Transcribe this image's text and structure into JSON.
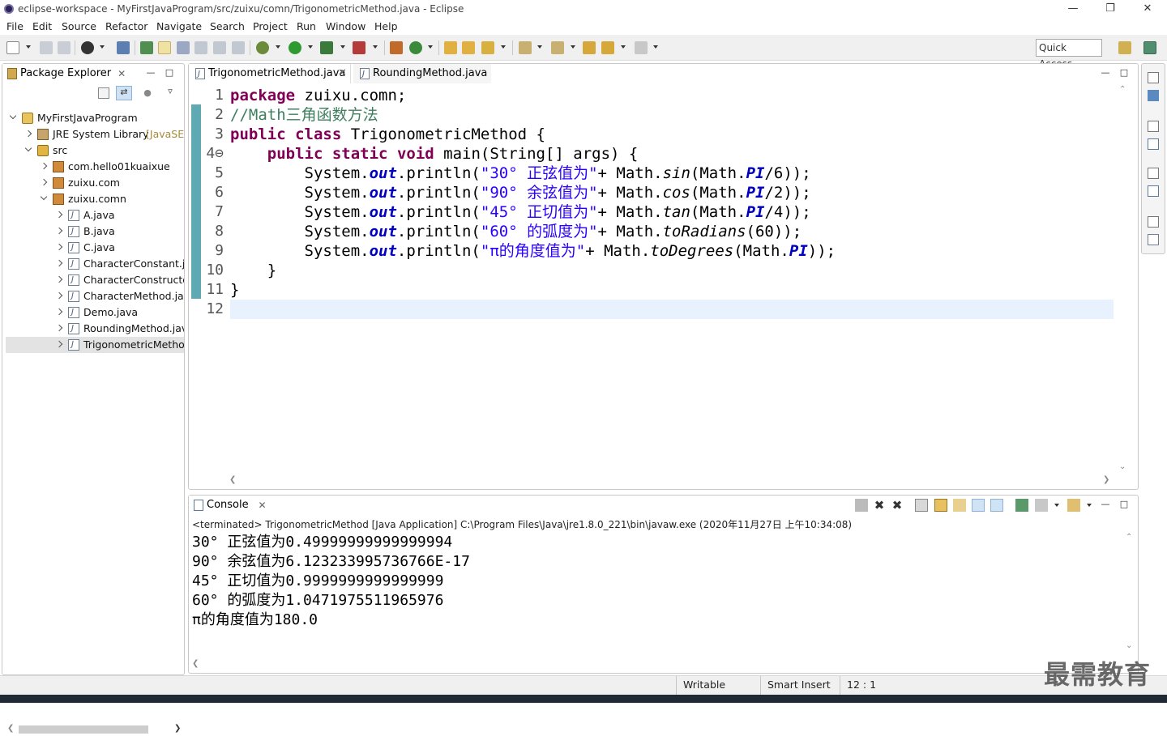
{
  "window": {
    "title": "eclipse-workspace - MyFirstJavaProgram/src/zuixu/comn/TrigonometricMethod.java - Eclipse"
  },
  "menu": [
    "File",
    "Edit",
    "Source",
    "Refactor",
    "Navigate",
    "Search",
    "Project",
    "Run",
    "Window",
    "Help"
  ],
  "toolbar": {
    "quick_access": "Quick Access"
  },
  "package_explorer": {
    "title": "Package Explorer",
    "tree": [
      {
        "label": "MyFirstJavaProgram",
        "level": 0,
        "icon": "project",
        "state": "expanded"
      },
      {
        "label": "JRE System Library",
        "suffix": " [JavaSE-",
        "level": 1,
        "icon": "library",
        "state": "collapsed"
      },
      {
        "label": "src",
        "level": 1,
        "icon": "source-folder",
        "state": "expanded"
      },
      {
        "label": "com.hello01kuaixue",
        "level": 2,
        "icon": "package",
        "state": "collapsed"
      },
      {
        "label": "zuixu.com",
        "level": 2,
        "icon": "package",
        "state": "collapsed"
      },
      {
        "label": "zuixu.comn",
        "level": 2,
        "icon": "package",
        "state": "expanded"
      },
      {
        "label": "A.java",
        "level": 3,
        "icon": "java-file",
        "state": "collapsed"
      },
      {
        "label": "B.java",
        "level": 3,
        "icon": "java-file",
        "state": "collapsed"
      },
      {
        "label": "C.java",
        "level": 3,
        "icon": "java-file",
        "state": "collapsed"
      },
      {
        "label": "CharacterConstant.ja",
        "level": 3,
        "icon": "java-file",
        "state": "collapsed"
      },
      {
        "label": "CharacterConstructor",
        "level": 3,
        "icon": "java-file",
        "state": "collapsed"
      },
      {
        "label": "CharacterMethod.jav",
        "level": 3,
        "icon": "java-file",
        "state": "collapsed"
      },
      {
        "label": "Demo.java",
        "level": 3,
        "icon": "java-file",
        "state": "collapsed"
      },
      {
        "label": "RoundingMethod.jav",
        "level": 3,
        "icon": "java-file",
        "state": "collapsed"
      },
      {
        "label": "TrigonometricMetho",
        "level": 3,
        "icon": "java-file",
        "state": "collapsed",
        "selected": true
      }
    ]
  },
  "editor": {
    "tabs": [
      {
        "label": "TrigonometricMethod.java",
        "active": true
      },
      {
        "label": "RoundingMethod.java",
        "active": false
      }
    ],
    "lines": [
      {
        "n": "1",
        "tokens": [
          [
            "kw",
            "package"
          ],
          [
            "pl",
            " zuixu.comn;"
          ]
        ]
      },
      {
        "n": "2",
        "tokens": [
          [
            "cm",
            "//Math三角函数方法"
          ]
        ]
      },
      {
        "n": "3",
        "tokens": [
          [
            "kw",
            "public"
          ],
          [
            "pl",
            " "
          ],
          [
            "kw",
            "class"
          ],
          [
            "pl",
            " TrigonometricMethod {"
          ]
        ]
      },
      {
        "n": "4⊖",
        "tokens": [
          [
            "pl",
            "    "
          ],
          [
            "kw",
            "public"
          ],
          [
            "pl",
            " "
          ],
          [
            "kw",
            "static"
          ],
          [
            "pl",
            " "
          ],
          [
            "kw",
            "void"
          ],
          [
            "pl",
            " main(String[] args) {"
          ]
        ]
      },
      {
        "n": "5",
        "tokens": [
          [
            "pl",
            "        System."
          ],
          [
            "fld",
            "out"
          ],
          [
            "pl",
            ".println("
          ],
          [
            "st",
            "\"30° 正弦值为\""
          ],
          [
            "pl",
            "+ Math."
          ],
          [
            "sm",
            "sin"
          ],
          [
            "pl",
            "(Math."
          ],
          [
            "fld",
            "PI"
          ],
          [
            "pl",
            "/6));"
          ]
        ]
      },
      {
        "n": "6",
        "tokens": [
          [
            "pl",
            "        System."
          ],
          [
            "fld",
            "out"
          ],
          [
            "pl",
            ".println("
          ],
          [
            "st",
            "\"90° 余弦值为\""
          ],
          [
            "pl",
            "+ Math."
          ],
          [
            "sm",
            "cos"
          ],
          [
            "pl",
            "(Math."
          ],
          [
            "fld",
            "PI"
          ],
          [
            "pl",
            "/2));"
          ]
        ]
      },
      {
        "n": "7",
        "tokens": [
          [
            "pl",
            "        System."
          ],
          [
            "fld",
            "out"
          ],
          [
            "pl",
            ".println("
          ],
          [
            "st",
            "\"45° 正切值为\""
          ],
          [
            "pl",
            "+ Math."
          ],
          [
            "sm",
            "tan"
          ],
          [
            "pl",
            "(Math."
          ],
          [
            "fld",
            "PI"
          ],
          [
            "pl",
            "/4));"
          ]
        ]
      },
      {
        "n": "8",
        "tokens": [
          [
            "pl",
            "        System."
          ],
          [
            "fld",
            "out"
          ],
          [
            "pl",
            ".println("
          ],
          [
            "st",
            "\"60° 的弧度为\""
          ],
          [
            "pl",
            "+ Math."
          ],
          [
            "sm",
            "toRadians"
          ],
          [
            "pl",
            "(60));"
          ]
        ]
      },
      {
        "n": "9",
        "tokens": [
          [
            "pl",
            "        System."
          ],
          [
            "fld",
            "out"
          ],
          [
            "pl",
            ".println("
          ],
          [
            "st",
            "\"π的角度值为\""
          ],
          [
            "pl",
            "+ Math."
          ],
          [
            "sm",
            "toDegrees"
          ],
          [
            "pl",
            "(Math."
          ],
          [
            "fld",
            "PI"
          ],
          [
            "pl",
            "));"
          ]
        ]
      },
      {
        "n": "10",
        "tokens": [
          [
            "pl",
            "    }"
          ]
        ]
      },
      {
        "n": "11",
        "tokens": [
          [
            "pl",
            "}"
          ]
        ]
      },
      {
        "n": "12",
        "tokens": []
      }
    ]
  },
  "console": {
    "title": "Console",
    "header": "<terminated> TrigonometricMethod [Java Application] C:\\Program Files\\Java\\jre1.8.0_221\\bin\\javaw.exe (2020年11月27日 上午10:34:08)",
    "output": [
      "30° 正弦值为0.49999999999999994",
      "90° 余弦值为6.123233995736766E-17",
      "45° 正切值为0.9999999999999999",
      "60° 的弧度为1.0471975511965976",
      "π的角度值为180.0"
    ]
  },
  "statusbar": {
    "writable": "Writable",
    "insert_mode": "Smart Insert",
    "position": "12 : 1"
  },
  "watermark": "最需教育"
}
